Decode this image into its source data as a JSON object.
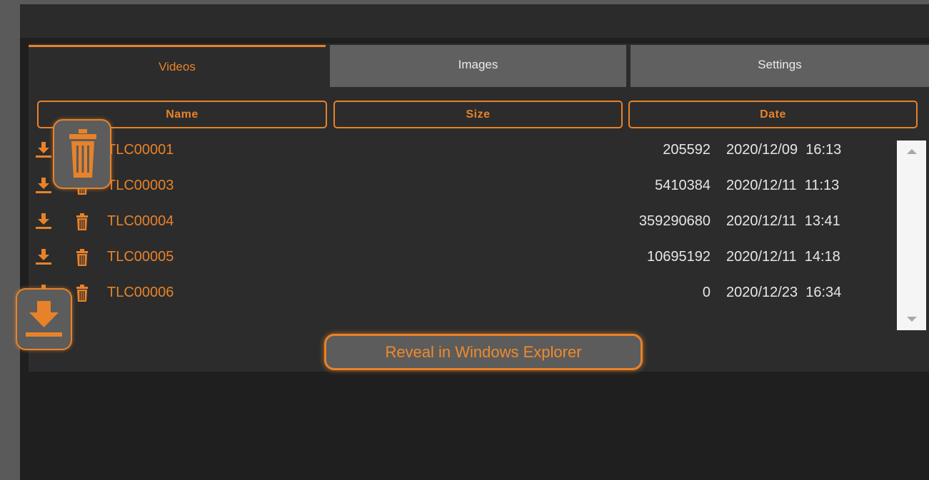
{
  "tabs": [
    {
      "label": "Videos",
      "active": true
    },
    {
      "label": "Images",
      "active": false
    },
    {
      "label": "Settings",
      "active": false
    }
  ],
  "columns": [
    "Name",
    "Size",
    "Date"
  ],
  "files": [
    {
      "name": "TLC00001",
      "size": "205592",
      "date": "2020/12/09  16:13"
    },
    {
      "name": "TLC00003",
      "size": "5410384",
      "date": "2020/12/11  11:13"
    },
    {
      "name": "TLC00004",
      "size": "359290680",
      "date": "2020/12/11  13:41"
    },
    {
      "name": "TLC00005",
      "size": "10695192",
      "date": "2020/12/11  14:18"
    },
    {
      "name": "TLC00006",
      "size": "0",
      "date": "2020/12/23  16:34"
    }
  ],
  "reveal_button": "Reveal in Windows Explorer",
  "icons": {
    "download": "download-icon",
    "delete": "trash-icon"
  },
  "colors": {
    "accent": "#e8822a",
    "panel": "#2c2c2c",
    "tab_inactive": "#606060"
  }
}
